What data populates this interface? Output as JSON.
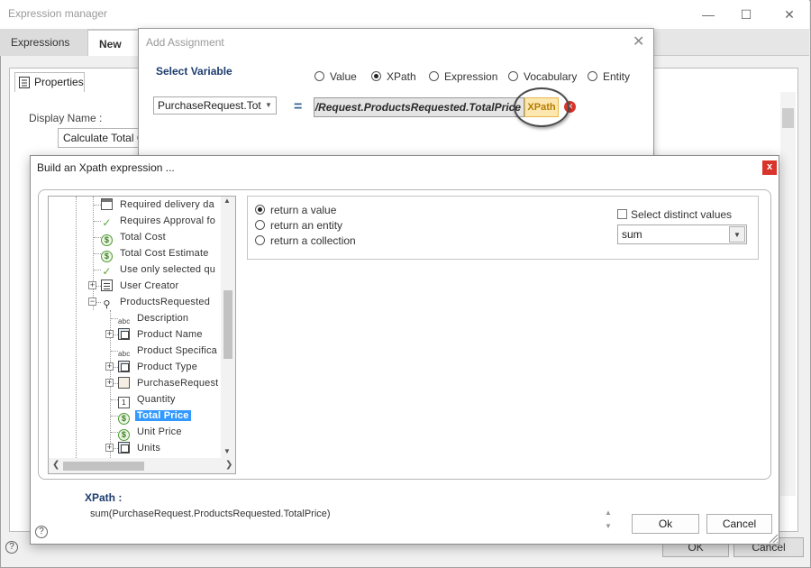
{
  "expression_manager": {
    "title": "Expression manager",
    "window_controls": {
      "minimize": "—",
      "maximize": "☐",
      "close": "✕"
    },
    "tabs": [
      {
        "label": "Expressions"
      },
      {
        "label": "New"
      }
    ],
    "properties_tab": "Properties",
    "display_name_label": "Display Name :",
    "display_name_value": "Calculate Total Cost",
    "ok_label": "OK",
    "cancel_label": "Cancel",
    "help": "?"
  },
  "add_assignment": {
    "title": "Add Assignment",
    "close": "✕",
    "select_variable_label": "Select Variable",
    "value_types": [
      {
        "label": "Value",
        "selected": false
      },
      {
        "label": "XPath",
        "selected": true
      },
      {
        "label": "Expression",
        "selected": false
      },
      {
        "label": "Vocabulary",
        "selected": false
      },
      {
        "label": "Entity",
        "selected": false
      }
    ],
    "variable_value": "PurchaseRequest.Tot",
    "equals": "=",
    "expression_text": "/Request.ProductsRequested.TotalPrice",
    "xpath_badge": "XPath",
    "remove_icon": "✕"
  },
  "xpath_builder": {
    "title": "Build an Xpath expression ...",
    "close": "x",
    "tree": [
      {
        "label": "Required delivery da",
        "icon": "date-icon"
      },
      {
        "label": "Requires Approval fo",
        "icon": "check-icon"
      },
      {
        "label": "Total Cost",
        "icon": "dollar-icon"
      },
      {
        "label": "Total Cost Estimate",
        "icon": "dollar-icon"
      },
      {
        "label": "Use only selected qu",
        "icon": "check-icon"
      },
      {
        "label": "User Creator",
        "icon": "entity-icon"
      },
      {
        "label": "ProductsRequested",
        "icon": "relation-icon"
      },
      {
        "label": "Description",
        "icon": "text-icon"
      },
      {
        "label": "Product Name",
        "icon": "collection-icon"
      },
      {
        "label": "Product Specifica",
        "icon": "text-icon"
      },
      {
        "label": "Product Type",
        "icon": "collection-icon"
      },
      {
        "label": "PurchaseRequest",
        "icon": "package-icon"
      },
      {
        "label": "Quantity",
        "icon": "number-icon"
      },
      {
        "label": "Total Price",
        "icon": "dollar-icon",
        "selected": true
      },
      {
        "label": "Unit Price",
        "icon": "dollar-icon"
      },
      {
        "label": "Units",
        "icon": "collection-icon"
      }
    ],
    "return_options": [
      {
        "label": "return a value",
        "selected": true
      },
      {
        "label": "return an entity",
        "selected": false
      },
      {
        "label": "return a collection",
        "selected": false
      }
    ],
    "distinct_label": "Select distinct values",
    "distinct_checked": false,
    "aggregate_value": "sum",
    "xpath_label": "XPath :",
    "xpath_value": "sum(PurchaseRequest.ProductsRequested.TotalPrice)",
    "ok_label": "Ok",
    "cancel_label": "Cancel",
    "help": "?"
  },
  "colors": {
    "accent_blue": "#1d3c6e",
    "selection": "#3399ff",
    "xpath_badge_bg": "#fde7b0",
    "close_red": "#d9342b"
  }
}
